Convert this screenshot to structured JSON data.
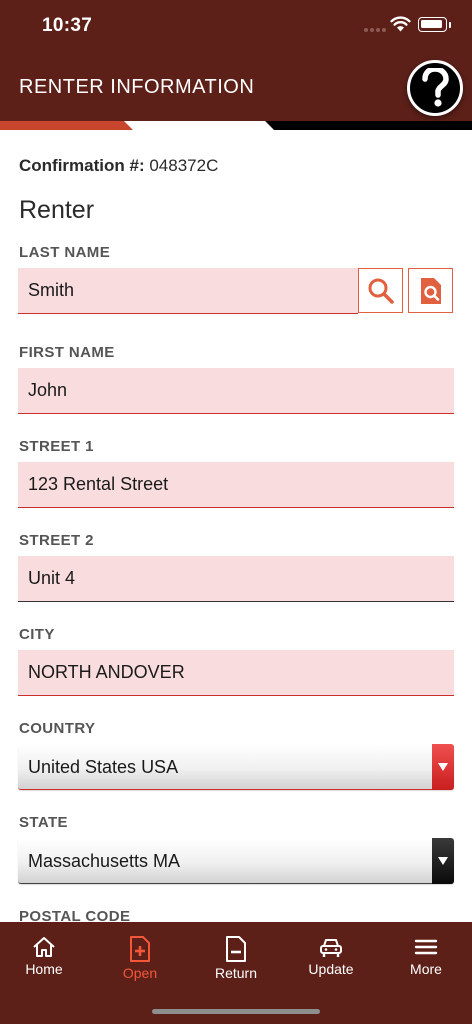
{
  "status_bar": {
    "time": "10:37"
  },
  "header": {
    "title": "RENTER INFORMATION",
    "help_icon": "question-mark-icon"
  },
  "colors": {
    "header_bg": "#5c2019",
    "accent": "#f2573a",
    "field_bg": "#f9dcdd",
    "field_underline": "#c9302c"
  },
  "confirmation": {
    "label": "Confirmation #:",
    "value": "048372C"
  },
  "section": {
    "title": "Renter"
  },
  "fields": {
    "last_name": {
      "label": "LAST NAME",
      "value": "Smith"
    },
    "first_name": {
      "label": "FIRST NAME",
      "value": "John"
    },
    "street1": {
      "label": "STREET 1",
      "value": "123 Rental Street"
    },
    "street2": {
      "label": "STREET 2",
      "value": "Unit 4"
    },
    "city": {
      "label": "CITY",
      "value": "NORTH ANDOVER"
    },
    "country": {
      "label": "COUNTRY",
      "value": "United States USA"
    },
    "state": {
      "label": "STATE",
      "value": "Massachusetts MA"
    },
    "postal_code": {
      "label": "POSTAL CODE"
    }
  },
  "lookup_icons": [
    "search-icon",
    "document-search-icon"
  ],
  "tabs": [
    {
      "label": "Home",
      "icon": "home-icon",
      "active": false
    },
    {
      "label": "Open",
      "icon": "add-document-icon",
      "active": true
    },
    {
      "label": "Return",
      "icon": "remove-document-icon",
      "active": false
    },
    {
      "label": "Update",
      "icon": "car-icon",
      "active": false
    },
    {
      "label": "More",
      "icon": "menu-icon",
      "active": false
    }
  ]
}
